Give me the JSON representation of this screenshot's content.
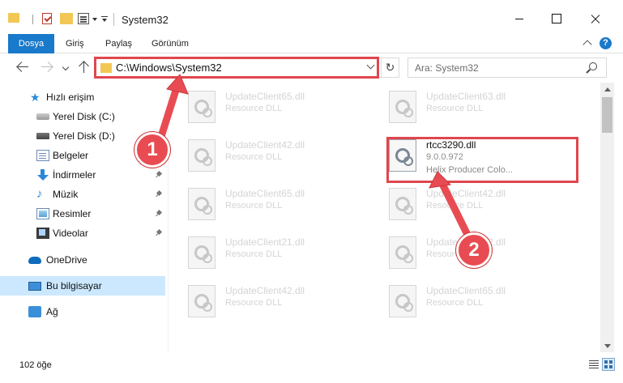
{
  "window": {
    "title": "System32"
  },
  "ribbon": {
    "tabs": [
      {
        "label": "Dosya"
      },
      {
        "label": "Giriş"
      },
      {
        "label": "Paylaş"
      },
      {
        "label": "Görünüm"
      }
    ],
    "help_label": "?"
  },
  "address": {
    "path": "C:\\Windows\\System32",
    "refresh_glyph": "↻"
  },
  "search": {
    "placeholder": "Ara: System32"
  },
  "sidebar": {
    "items": [
      {
        "label": "Hızlı erişim",
        "icon": "star-icon"
      },
      {
        "label": "Yerel Disk (C:)",
        "icon": "drive-icon"
      },
      {
        "label": "Yerel Disk (D:)",
        "icon": "drive-icon"
      },
      {
        "label": "Belgeler",
        "icon": "documents-icon"
      },
      {
        "label": "İndirmeler",
        "icon": "downloads-icon"
      },
      {
        "label": "Müzik",
        "icon": "music-icon"
      },
      {
        "label": "Resimler",
        "icon": "pictures-icon"
      },
      {
        "label": "Videolar",
        "icon": "videos-icon"
      },
      {
        "label": "OneDrive",
        "icon": "cloud-icon"
      },
      {
        "label": "Bu bilgisayar",
        "icon": "computer-icon"
      },
      {
        "label": "Ağ",
        "icon": "network-icon"
      }
    ]
  },
  "files": [
    {
      "name": "UpdateClient65.dll",
      "desc": "Resource DLL"
    },
    {
      "name": "UpdateClient63.dll",
      "desc": "Resource DLL"
    },
    {
      "name": "UpdateClient42.dll",
      "desc": "Resource DLL"
    },
    {
      "name": "rtcc3290.dll",
      "version": "9.0.0.972",
      "desc": "Helix Producer Colo..."
    },
    {
      "name": "UpdateClient65.dll",
      "desc": "Resource DLL"
    },
    {
      "name": "UpdateClient42.dll",
      "desc": "Resource DLL"
    },
    {
      "name": "UpdateClient21.dll",
      "desc": "Resource DLL"
    },
    {
      "name": "UpdateClient42.dll",
      "desc": "Resource DLL"
    },
    {
      "name": "UpdateClient42.dll",
      "desc": "Resource DLL"
    },
    {
      "name": "UpdateClient65.dll",
      "desc": "Resource DLL"
    }
  ],
  "status": {
    "count": "102 öğe"
  },
  "annotations": {
    "badge1": "1",
    "badge2": "2",
    "color": "#e84c52"
  }
}
